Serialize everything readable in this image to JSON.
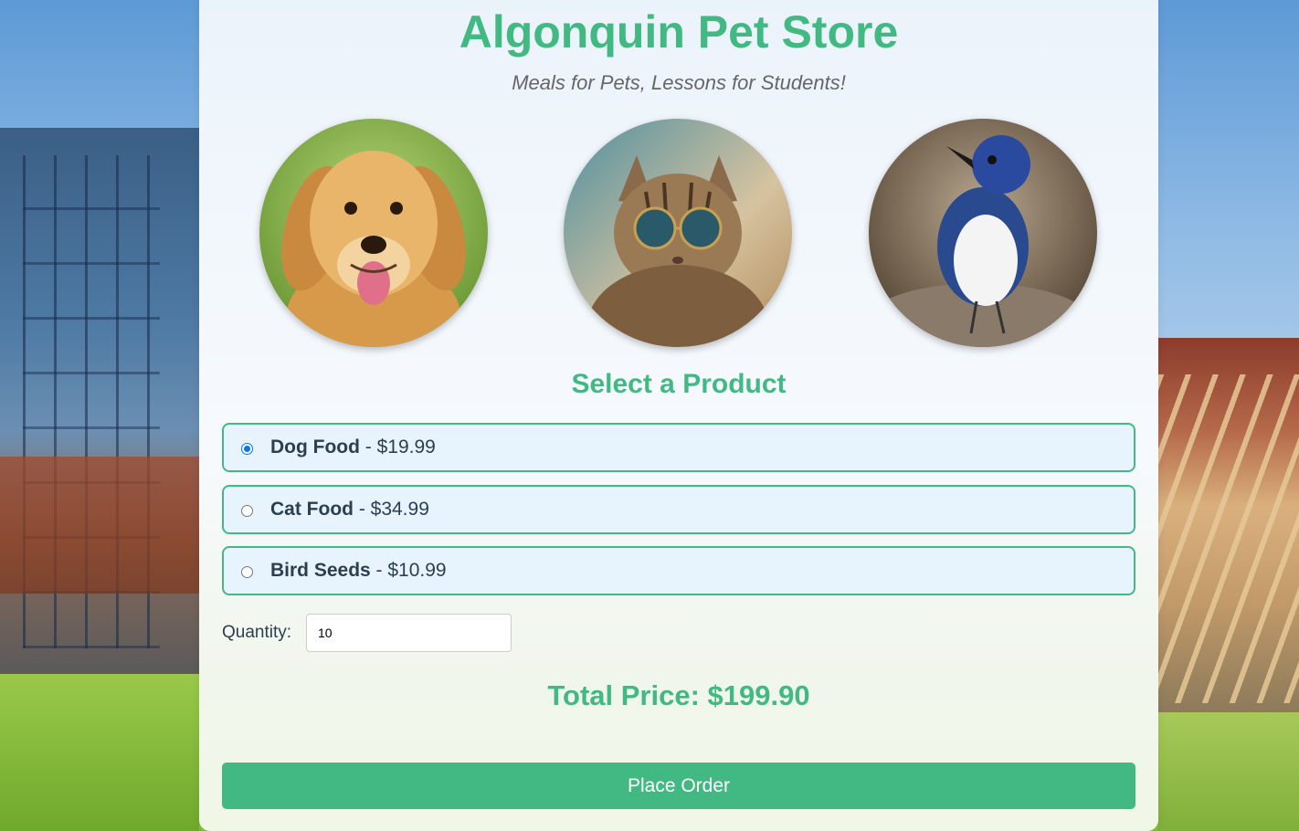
{
  "header": {
    "title": "Algonquin Pet Store",
    "subtitle": "Meals for Pets, Lessons for Students!"
  },
  "gallery": {
    "images": [
      {
        "name": "dog-photo"
      },
      {
        "name": "cat-photo"
      },
      {
        "name": "bird-photo"
      }
    ]
  },
  "product_section": {
    "heading": "Select a Product",
    "options": [
      {
        "name": "Dog Food",
        "price": " - $19.99",
        "selected": true
      },
      {
        "name": "Cat Food",
        "price": " - $34.99",
        "selected": false
      },
      {
        "name": "Bird Seeds",
        "price": " - $10.99",
        "selected": false
      }
    ]
  },
  "quantity": {
    "label": "Quantity:",
    "value": "10"
  },
  "total": {
    "text": "Total Price: $199.90"
  },
  "order": {
    "button_label": "Place Order"
  },
  "colors": {
    "accent": "#42b983",
    "option_bg": "#e8f4fd",
    "text": "#2c3e50",
    "radio_selected": "#0075ff"
  }
}
